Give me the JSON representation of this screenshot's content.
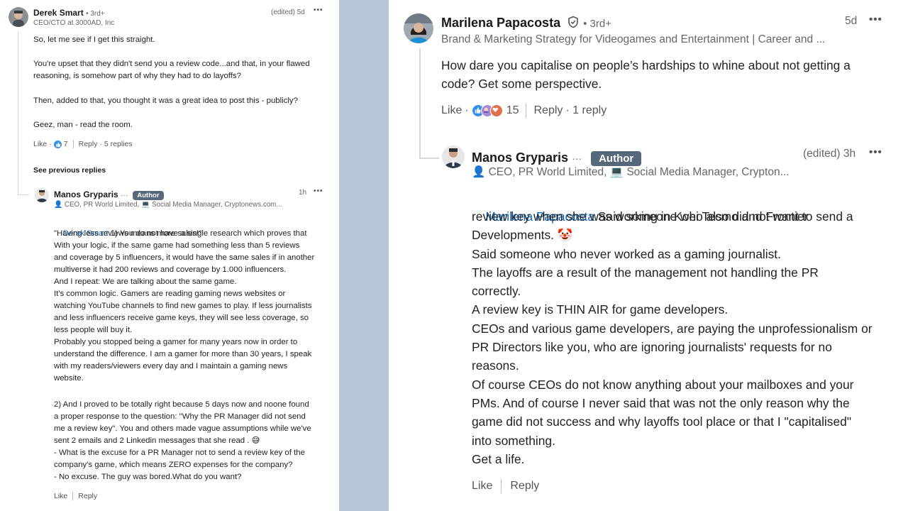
{
  "left": {
    "comment1": {
      "name": "Derek Smart",
      "degree": "• 3rd+",
      "headline": "CEO/CTO at 3000AD, Inc",
      "edited": "(edited) 5d",
      "more": "•••",
      "paragraphs": [
        "So, let me see if I get this straight.",
        "You're upset that they didn't send you a review code...and that, in your flawed\nreasoning, is somehow part of why they had to do layoffs?",
        "Then, added to that, you thought it was a great idea to post this - publicly?",
        "Geez, man - read the room."
      ],
      "like": "Like",
      "like_dot": "·",
      "like_count": "7",
      "reply": "Reply",
      "replies": "· 5 replies"
    },
    "see_previous": "See previous replies",
    "reply1": {
      "name": "Manos Gryparis",
      "ellipsis": "···",
      "author_label": "Author",
      "time": "1h",
      "more": "•••",
      "headline": "👤 CEO, PR World Limited, 💻 Social Media Manager, Cryptonews.com...",
      "mention": "Derek Smart",
      "first_line_rest": " 1) You do not have a single research which proves that",
      "body1": "\"Having less reviews means more sales!\"\nWith your logic, if the same game had something less than 5 reviews\nand coverage by 5 influencers, it would have the same sales if in another\nmultiverse it had 200 reviews and coverage by 1.000 influencers.\nAnd I repeat: We are talking about the same game.\nIt's common logic. Gamers are reading gaming news websites or\nwatching YouTube channels to find new games to play. If less journalists\nand less influencers receive game keys, they will see less coverage, so\nless people will buy it.\nProbably you stopped being a gamer for many years now in order to\nunderstand the difference. I am a gamer for more than 30 years, I speak\nwith my readers/viewers every day and I maintain a gaming news\nwebsite.",
      "body2": "2) And I proved to be totally right because 5 days now and noone found\na proper response to the question: \"Why the PR Manager did not send\nme a review key\". You and others made vague assumptions while we've\nsent 2 emails and 2 Linkedin messages that she read . 😅\n- What is the excuse for a PR Manager not to send a review key of the\ncompany's game, which means ZERO expenses for the company?\n- No excuse. The guy was bored.What do you want?",
      "like": "Like",
      "reply": "Reply"
    }
  },
  "right": {
    "comment": {
      "name": "Marilena Papacosta",
      "degree": "• 3rd+",
      "headline": "Brand & Marketing Strategy for Videogames and Entertainment | Career and ...",
      "time": "5d",
      "more": "•••",
      "body": "How dare you capitalise on people’s hardships to whine about not getting a\ncode? Get some perspective.",
      "like": "Like",
      "like_dot": "·",
      "reaction_count": "15",
      "reply": "Reply",
      "replies": "· 1 reply"
    },
    "reply": {
      "name": "Manos Gryparis",
      "ellipsis": "···",
      "author_label": "Author",
      "edited": "(edited) 3h",
      "more": "•••",
      "headline": "👤 CEO, PR World Limited, 💻 Social Media Manager, Crypton...",
      "mention": "Marilena Papacosta",
      "first_line_rest": " Said someone who also did not want to send a",
      "body": "review key when she was working in Koei Tecmo and Frontier\nDevelopments. 🤡\nSaid someone who never worked as a gaming journalist.\nThe layoffs are a result of the management not handling the PR\ncorrectly.\nA review key is THIN AIR for game developers.\nCEOs and various game developers, are paying the unprofessionalism or\nPR Directors like you, who are ignoring journalists' requests for no\nreasons.\nOf course CEOs do not know anything about your mailboxes and your\nPMs. And of course I never said that was not the only reason why the\ngame did not success and why layoffs tool place or that I \"capitalised\"\ninto something.\nGet a life.",
      "like": "Like",
      "reply": "Reply"
    }
  },
  "colors": {
    "link_blue": "#0a66c2",
    "author_badge": "#56687a",
    "divider_strip": "#b5c6d6",
    "like_blue": "#378fe9",
    "heart_red": "#df704d"
  }
}
